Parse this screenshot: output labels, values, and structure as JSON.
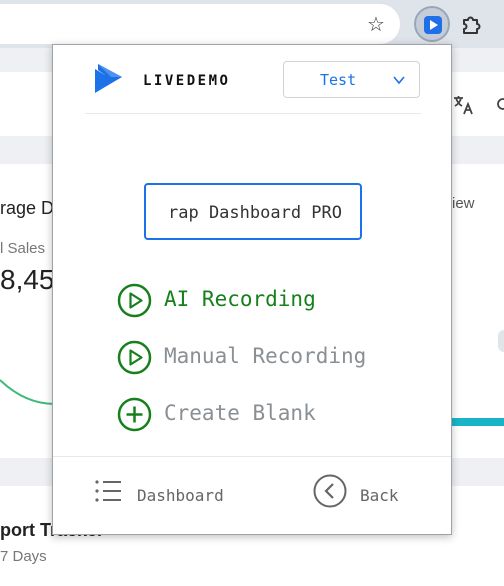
{
  "browser": {
    "bookmark_icon": "star-icon",
    "extension_icon": "livedemo-extension-icon",
    "extensions_menu_icon": "puzzle-icon"
  },
  "background_page": {
    "card_title": "rage D",
    "card_link": "iew",
    "metric_label": "l Sales",
    "metric_value": "8,45",
    "bottom_title": "port Tracker",
    "bottom_subtitle": "7 Days"
  },
  "popup": {
    "brand": "LIVEDEMO",
    "workspace": {
      "selected": "Test"
    },
    "demo_name": {
      "value": "Bootstrap Dashboard PRO",
      "visible_text": "rap Dashboard PRO"
    },
    "actions": [
      {
        "label": "AI Recording",
        "icon": "play-circle-icon",
        "color": "#17801c"
      },
      {
        "label": "Manual Recording",
        "icon": "play-circle-icon",
        "color": "#8a8f94"
      },
      {
        "label": "Create Blank",
        "icon": "plus-circle-icon",
        "color": "#8a8f94"
      }
    ],
    "footer": {
      "dashboard": "Dashboard",
      "back": "Back"
    }
  },
  "colors": {
    "accent": "#1a73e8",
    "green": "#17801c",
    "muted": "#8a8f94"
  }
}
